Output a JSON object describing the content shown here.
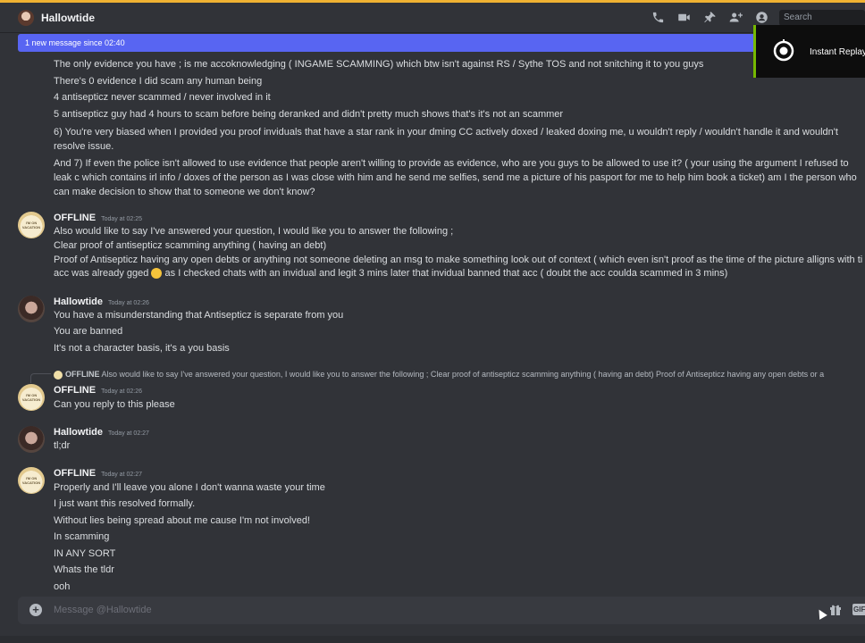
{
  "header": {
    "title": "Hallowtide",
    "search_placeholder": "Search",
    "icons": [
      "phone-call-icon",
      "video-icon",
      "pin-icon",
      "add-friend-icon",
      "profile-icon"
    ]
  },
  "banner": {
    "text": "1 new message since 02:40"
  },
  "replay": {
    "label": "Instant Replay"
  },
  "cont_lines": [
    "The only evidence you have ; is me accoknowledging ( INGAME SCAMMING) which btw isn't against RS / Sythe TOS and not snitching it to you guys",
    "There's 0 evidence I did scam any human being",
    "4 antisepticz never scammed / never involved in it",
    "5 antisepticz guy had 4 hours to scam before being deranked and didn't pretty much shows that's it's not an scammer",
    "6) You're very biased when I provided you proof inviduals that have a star rank in your dming CC actively doxed / leaked doxing me, u wouldn't reply / wouldn't handle it and wouldn't resolve issue.",
    "And 7) If even the police isn't allowed to use evidence that people aren't willing to provide as evidence, who are you guys to be allowed to use it? ( your using the argument I refused to leak c which contains irl info / doxes of the person as I was close with him and he send me selfies, send me a picture of his pasport for me to help him book a ticket) am I the person who can make decision to show that to someone we don't know?"
  ],
  "groups": [
    {
      "author": "OFFLINE",
      "timestamp": "Today at 02:25",
      "avatar_text": "I'M ON VACATION",
      "lines": [
        "Also would like to say I've answered your question, I would like you to answer the following ;",
        "Clear proof of antisepticz scamming anything ( having an debt)",
        "Proof of Antisepticz having any open debts or anything not someone deleting an msg to make something look out of context ( which even isn't proof as the time of the picture alligns with ti",
        "acc was already gged",
        "as I checked chats with an invidual and legit 3 mins later that invidual banned that acc ( doubt the acc coulda scammed in 3 mins)"
      ]
    },
    {
      "author": "Hallowtide",
      "timestamp": "Today at 02:26",
      "lines": [
        "You have a misunderstanding that Antisepticz is separate from you",
        "You are banned",
        "It's not a character basis, it's a you basis"
      ]
    },
    {
      "reply_author": "OFFLINE",
      "reply_text": "Also would like to say I've answered your question, I would like you to answer the following ; Clear proof of antisepticz scamming anything ( having an debt) Proof of Antisepticz having any open debts or a",
      "author": "OFFLINE",
      "timestamp": "Today at 02:26",
      "avatar_text": "I'M ON VACATION",
      "lines": [
        "Can you reply to this please"
      ]
    },
    {
      "author": "Hallowtide",
      "timestamp": "Today at 02:27",
      "lines": [
        "tl;dr"
      ]
    },
    {
      "author": "OFFLINE",
      "timestamp": "Today at 02:27",
      "avatar_text": "I'M ON VACATION",
      "lines": [
        "Properly and I'll leave you alone I don't wanna waste your time",
        "I just want this resolved formally.",
        "Without lies being spread about me cause I'm not involved!",
        "In scamming",
        "IN ANY SORT",
        "Whats the tldr",
        "ooh"
      ]
    }
  ],
  "composer": {
    "placeholder": "Message @Hallowtide",
    "gif_label": "GIF"
  },
  "colors": {
    "accent": "#5865f2",
    "background": "#313338",
    "nvidia": "#76b900"
  }
}
